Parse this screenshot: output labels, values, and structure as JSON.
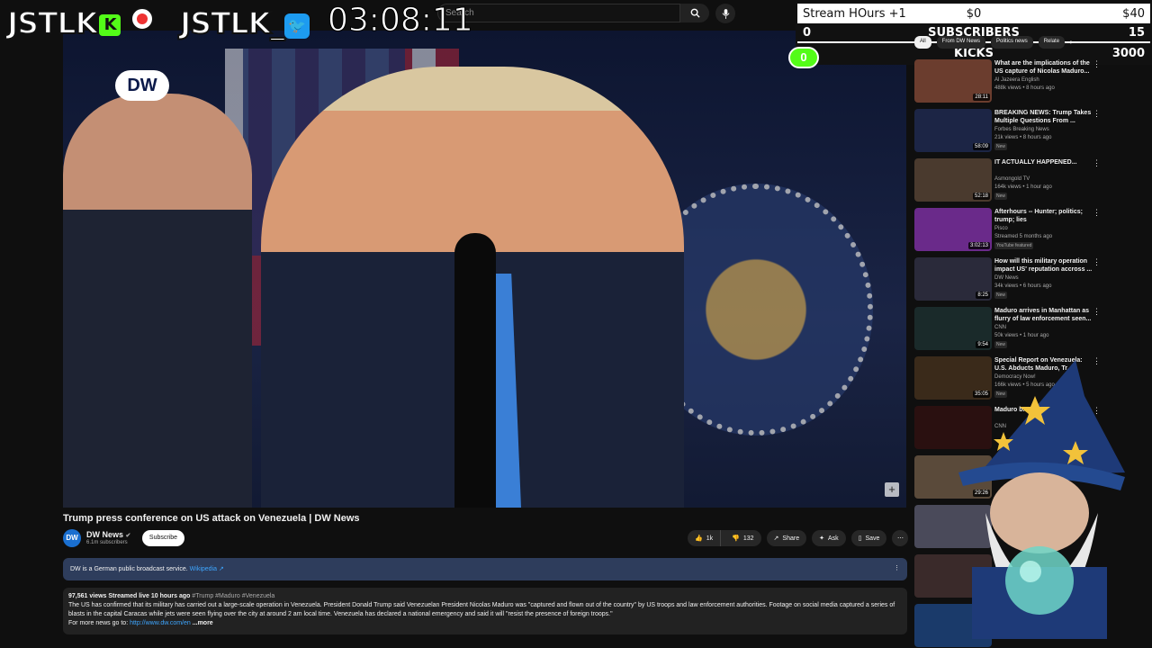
{
  "overlay": {
    "logo_kick": "JSTLK",
    "logo_twitter": "JSTLK_",
    "timer": "03:08:11",
    "stream_hours_label": "Stream HOurs +1",
    "stream_hours_mid": "$0",
    "stream_hours_right": "$40",
    "subscribers_left": "0",
    "subscribers_label": "SUBSCRIBERS",
    "subscribers_right": "15",
    "kicks_label": "KICKS",
    "kicks_right": "3000",
    "kicks_pill": "0"
  },
  "search": {
    "placeholder": "Search"
  },
  "video": {
    "watermark": "DW",
    "title": "Trump press conference on US attack on Venezuela | DW News",
    "channel": "DW News",
    "subscribers": "6.1m subscribers",
    "channel_avatar": "DW",
    "subscribe_label": "Subscribe",
    "likes": "1k",
    "dislikes": "132",
    "share_label": "Share",
    "ask_label": "Ask",
    "save_label": "Save"
  },
  "info_box": {
    "text": "DW is a German public broadcast service.",
    "link": "Wikipedia ↗"
  },
  "description": {
    "stats": "97,561 views  Streamed live 10 hours ago",
    "tags": "#Trump #Maduro #Venezuela",
    "body": "The US has confirmed that its military has carried out a large-scale operation in Venezuela. President Donald Trump said Venezuelan President Nicolas Maduro was \"captured and flown out of the country\" by US troops and law enforcement authorities. Footage on social media captured a series of blasts in the capital Caracas while jets were seen flying over the city at around 2 am local time. Venezuela has declared a national emergency and said it will \"resist the presence of foreign troops.\"",
    "more_prefix": "For more news go to:",
    "more_link": "http://www.dw.com/en",
    "more_label": "...more"
  },
  "chips": [
    "All",
    "From DW News",
    "Politics news",
    "Relate"
  ],
  "recommendations": [
    {
      "title": "What are the implications of the US capture of Nicolas Maduro...",
      "channel": "Al Jazeera English",
      "meta": "488k views • 8 hours ago",
      "duration": "28:11",
      "badge": "",
      "color": "#6b3d2e"
    },
    {
      "title": "BREAKING NEWS: Trump Takes Multiple Questions From ...",
      "channel": "Forbes Breaking News",
      "meta": "21k views • 8 hours ago",
      "duration": "58:09",
      "badge": "New",
      "color": "#1c2545"
    },
    {
      "title": "IT ACTUALLY HAPPENED...",
      "channel": "Asmongold TV",
      "meta": "164k views • 1 hour ago",
      "duration": "52:18",
      "badge": "New",
      "color": "#4a3a2e"
    },
    {
      "title": "Afterhours -- Hunter; politics; trump; lies",
      "channel": "Pisco",
      "meta": "Streamed 5 months ago",
      "duration": "3:02:13",
      "badge": "YouTube featured",
      "color": "#6a2a8a"
    },
    {
      "title": "How will this military operation impact US' reputation accross ...",
      "channel": "DW News",
      "meta": "34k views • 6 hours ago",
      "duration": "8:25",
      "badge": "New",
      "color": "#2a2a3a"
    },
    {
      "title": "Maduro arrives in Manhattan as flurry of law enforcement seen...",
      "channel": "CNN",
      "meta": "50k views • 1 hour ago",
      "duration": "9:54",
      "badge": "New",
      "color": "#1a2a2a"
    },
    {
      "title": "Special Report on Venezuela: U.S. Abducts Maduro, Tr...",
      "channel": "Democracy Now!",
      "meta": "166k views • 5 hours ago",
      "duration": "35:05",
      "badge": "New",
      "color": "#3a2a1a"
    },
    {
      "title": "Maduro b... expecte...",
      "channel": "CNN",
      "meta": "",
      "duration": "",
      "badge": "",
      "color": "#2a1010"
    },
    {
      "title": "",
      "channel": "",
      "meta": "",
      "duration": "29:26",
      "badge": "",
      "color": "#5a4a3a"
    },
    {
      "title": "",
      "channel": "",
      "meta": "",
      "duration": "",
      "badge": "",
      "color": "#4a4a5a"
    },
    {
      "title": "",
      "channel": "",
      "meta": "",
      "duration": "",
      "badge": "",
      "color": "#3a2a2a"
    },
    {
      "title": "",
      "channel": "",
      "meta": "",
      "duration": "",
      "badge": "",
      "color": "#1a3a6a"
    }
  ],
  "colors": {
    "accent": "#3ea6ff",
    "kick_green": "#53fc18",
    "twitter_blue": "#1d9bf0"
  }
}
